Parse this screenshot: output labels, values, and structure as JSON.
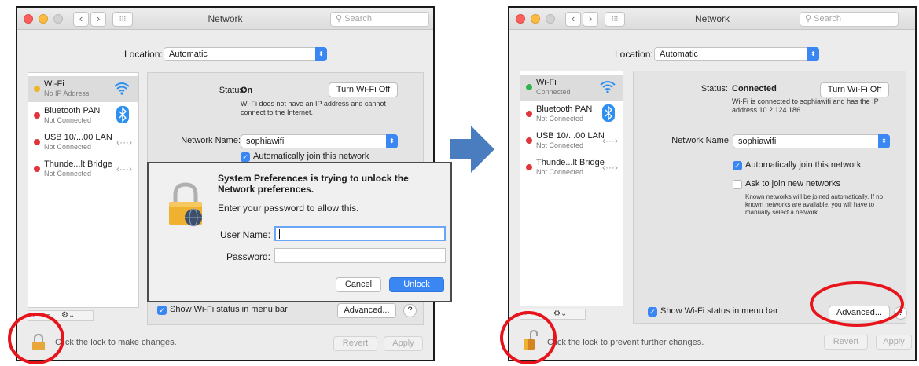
{
  "left": {
    "window_title": "Network",
    "search_placeholder": "Search",
    "location_label": "Location:",
    "location_value": "Automatic",
    "services": [
      {
        "name": "Wi-Fi",
        "status": "No IP Address",
        "dot": "#f0b429",
        "icon": "wifi-icon"
      },
      {
        "name": "Bluetooth PAN",
        "status": "Not Connected",
        "dot": "#e0353b",
        "icon": "bluetooth-icon"
      },
      {
        "name": "USB 10/...00 LAN",
        "status": "Not Connected",
        "dot": "#e0353b",
        "icon": "ethernet-icon"
      },
      {
        "name": "Thunde...lt Bridge",
        "status": "Not Connected",
        "dot": "#e0353b",
        "icon": "ethernet-icon"
      }
    ],
    "status_label": "Status:",
    "status_value": "On",
    "turn_off_button": "Turn Wi-Fi Off",
    "status_desc": "Wi-Fi does not have an IP address and cannot connect to the Internet.",
    "network_name_label": "Network Name:",
    "network_name_value": "sophiawifi",
    "auto_join": "Automatically join this network",
    "show_status": "Show Wi-Fi status in menu bar",
    "advanced_button": "Advanced...",
    "help_button": "?",
    "lock_text": "Click the lock to make changes.",
    "revert_button": "Revert",
    "apply_button": "Apply",
    "dialog": {
      "title": "System Preferences is trying to unlock the Network preferences.",
      "subtitle": "Enter your password to allow this.",
      "username_label": "User Name:",
      "password_label": "Password:",
      "cancel_button": "Cancel",
      "unlock_button": "Unlock"
    }
  },
  "right": {
    "window_title": "Network",
    "search_placeholder": "Search",
    "location_label": "Location:",
    "location_value": "Automatic",
    "services": [
      {
        "name": "Wi-Fi",
        "status": "Connected",
        "dot": "#2fb34b",
        "icon": "wifi-icon"
      },
      {
        "name": "Bluetooth PAN",
        "status": "Not Connected",
        "dot": "#e0353b",
        "icon": "bluetooth-icon"
      },
      {
        "name": "USB 10/...00 LAN",
        "status": "Not Connected",
        "dot": "#e0353b",
        "icon": "ethernet-icon"
      },
      {
        "name": "Thunde...lt Bridge",
        "status": "Not Connected",
        "dot": "#e0353b",
        "icon": "ethernet-icon"
      }
    ],
    "status_label": "Status:",
    "status_value": "Connected",
    "turn_off_button": "Turn Wi-Fi Off",
    "status_desc": "Wi-Fi is connected to sophiawifi and has the IP address 10.2.124.186.",
    "network_name_label": "Network Name:",
    "network_name_value": "sophiawifi",
    "auto_join": "Automatically join this network",
    "ask_join": "Ask to join new networks",
    "ask_join_desc": "Known networks will be joined automatically. If no known networks are available, you will have to manually select a network.",
    "show_status": "Show Wi-Fi status in menu bar",
    "advanced_button": "Advanced...",
    "help_button": "?",
    "lock_text": "Click the lock to prevent further changes.",
    "revert_button": "Revert",
    "apply_button": "Apply"
  },
  "colors": {
    "accent": "#3a87f3",
    "highlight_ring": "#e8141b",
    "arrow": "#4a7dbf"
  }
}
